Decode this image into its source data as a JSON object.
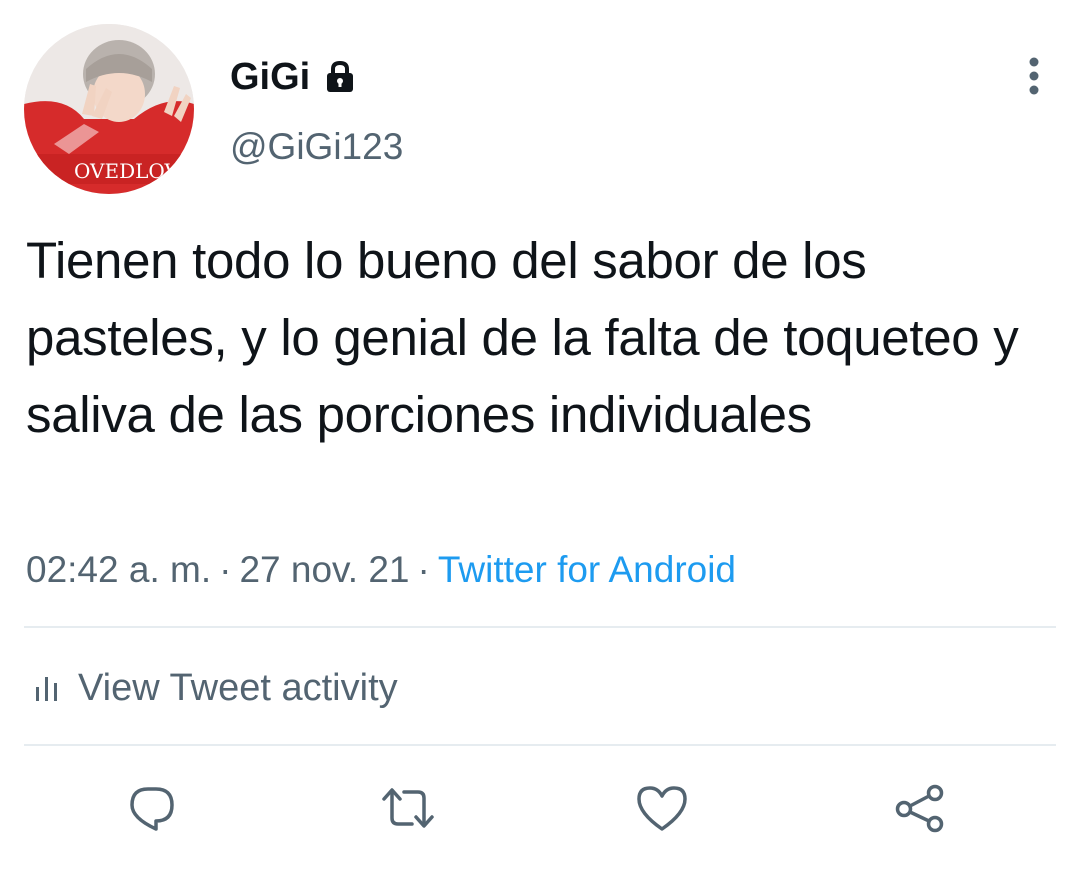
{
  "author": {
    "display_name": "GiGi",
    "handle": "@GiGi123",
    "protected": true,
    "avatar_shirt_text": "OVEDLOVE"
  },
  "tweet": {
    "text": "Tienen todo lo bueno del sabor de los pasteles, y lo genial de la falta de toqueteo y saliva de las porciones individuales",
    "time": "02:42 a. m.",
    "date": "27 nov. 21",
    "source": "Twitter for Android",
    "separator": "·"
  },
  "activity": {
    "label": "View Tweet activity"
  },
  "actions": {
    "reply_icon": "reply-icon",
    "retweet_icon": "retweet-icon",
    "like_icon": "heart-icon",
    "share_icon": "share-icon"
  },
  "colors": {
    "text": "#0f1419",
    "secondary": "#536471",
    "link": "#1d9bf0",
    "divider": "#e6ecf0"
  }
}
